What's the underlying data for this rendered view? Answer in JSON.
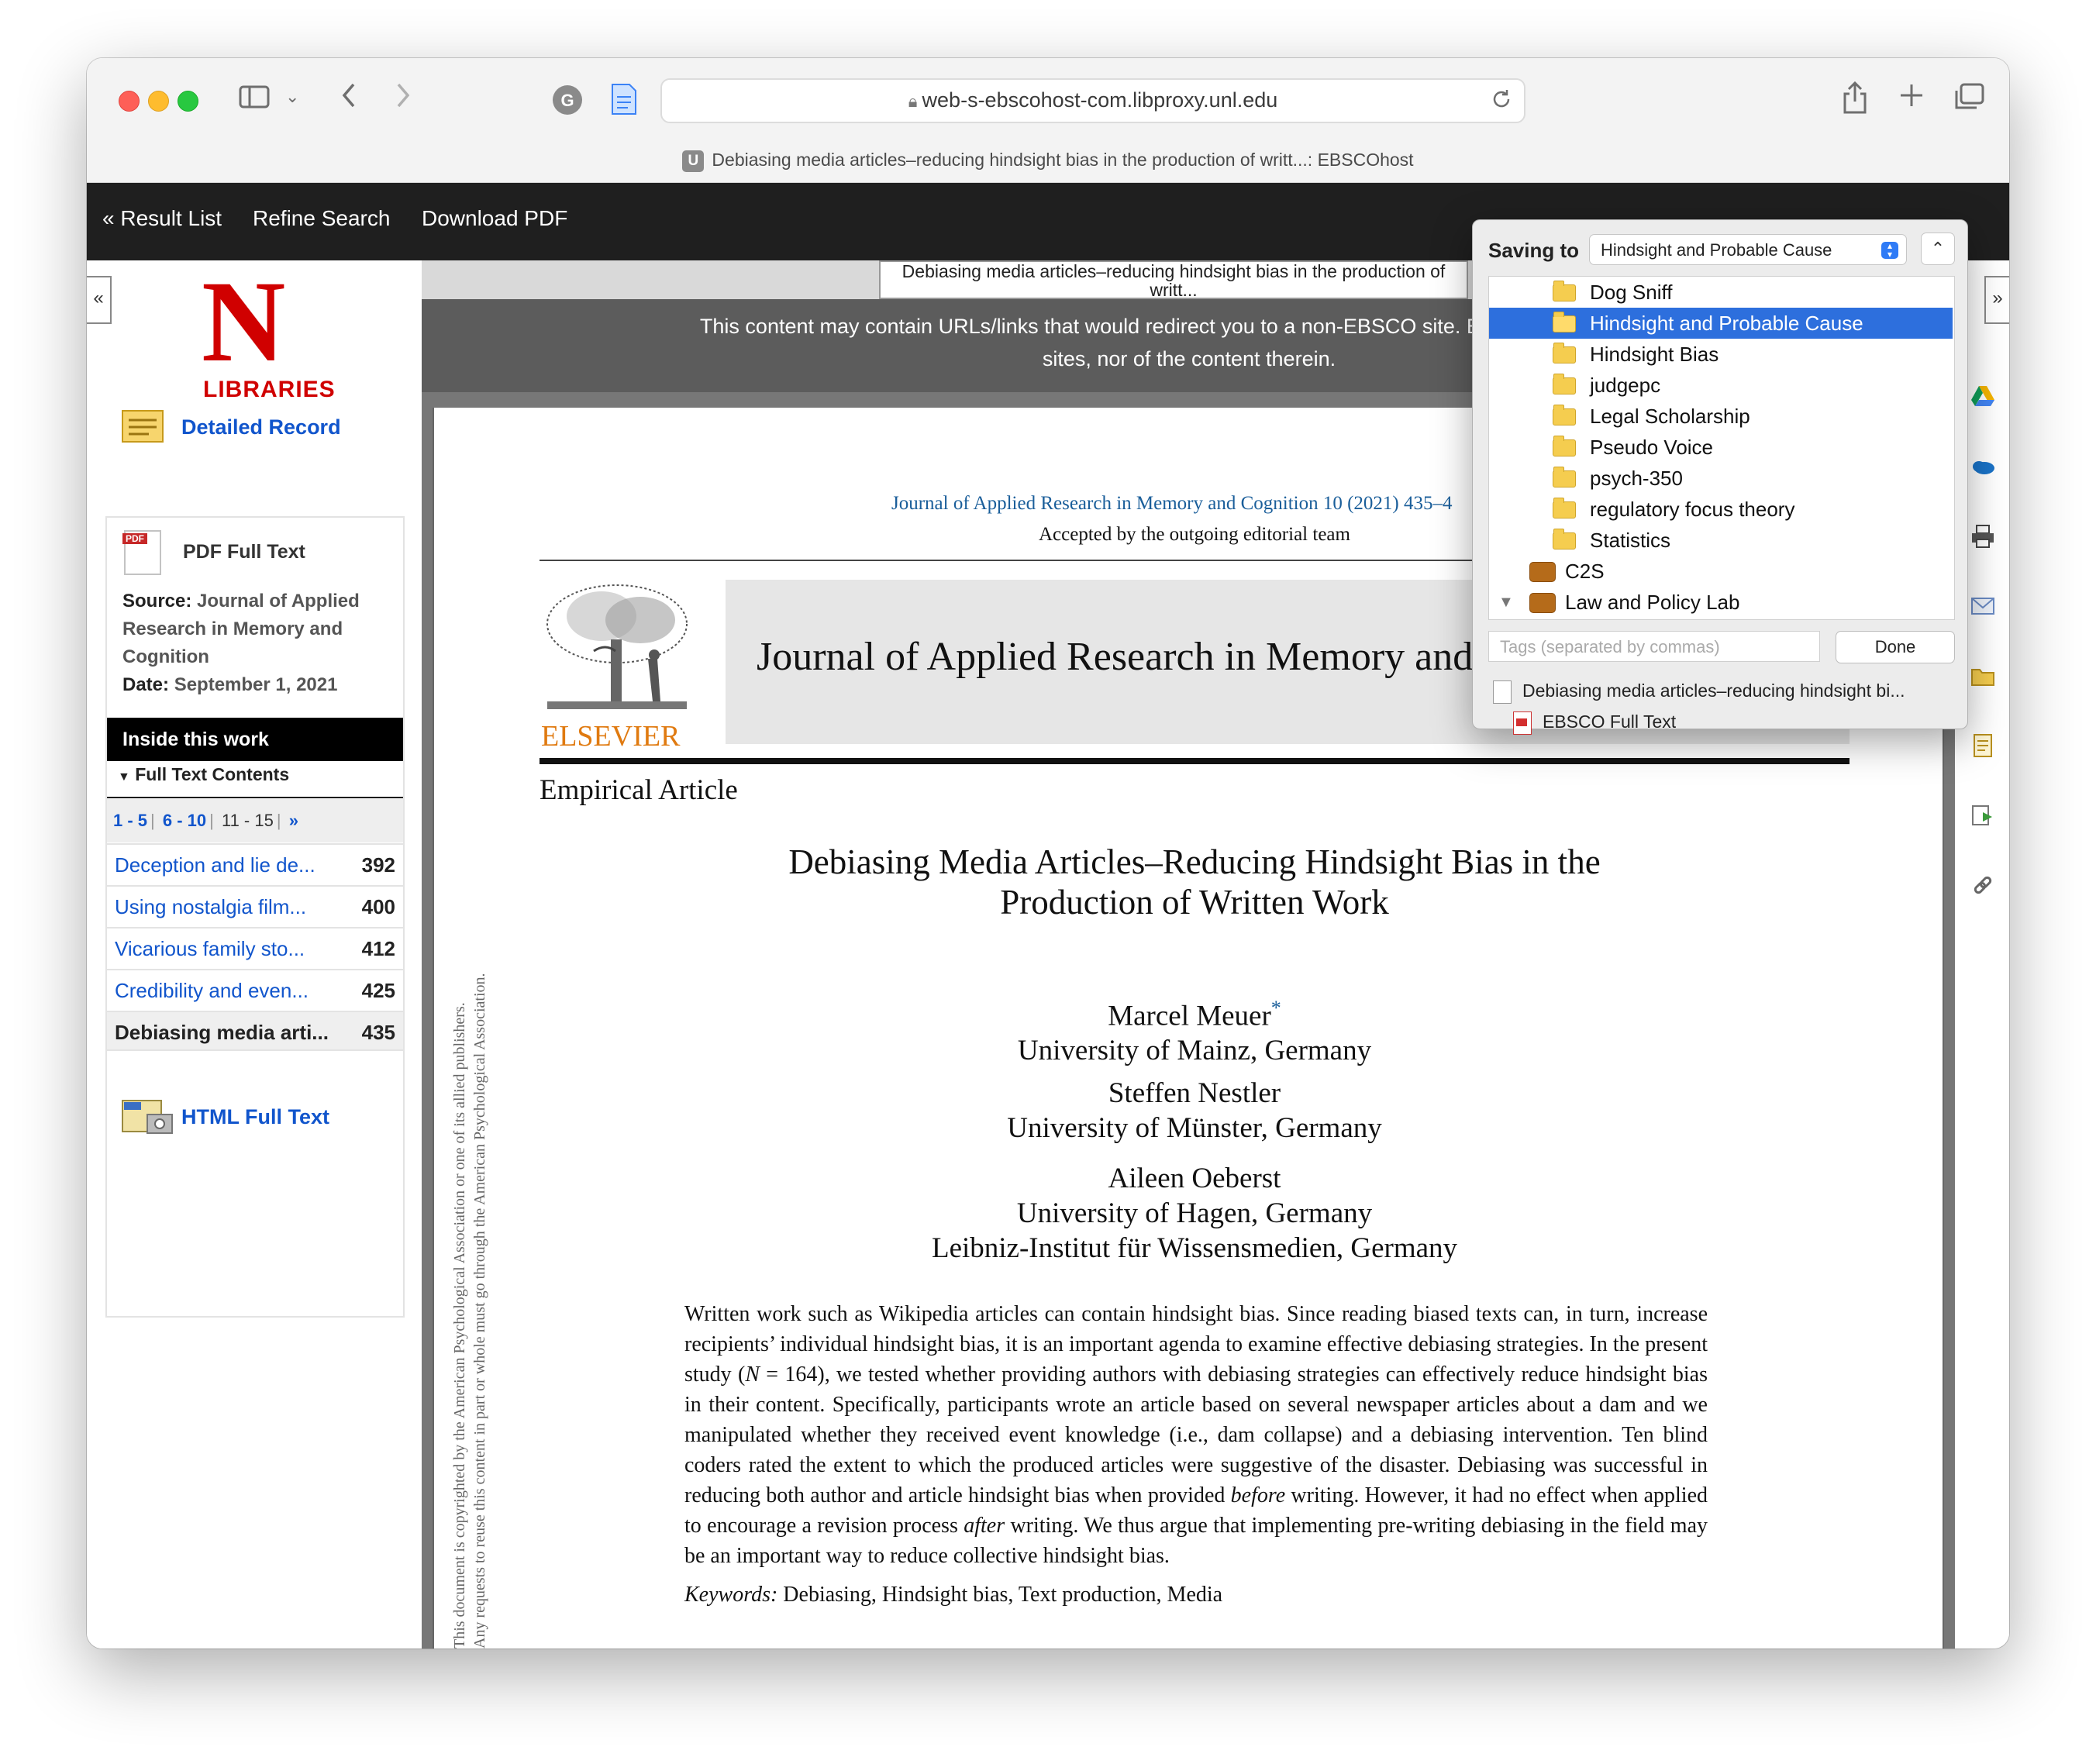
{
  "browser": {
    "url": "web-s-ebscohost-com.libproxy.unl.edu",
    "tab_title": "Debiasing media articles–reducing hindsight bias in the production of writt...: EBSCOhost",
    "tab_favicon": "U"
  },
  "nav": {
    "result_list": "« Result List",
    "refine_search": "Refine Search",
    "download_pdf": "Download PDF"
  },
  "sidebar": {
    "logo_letter": "N",
    "logo_text": "LIBRARIES",
    "detailed_record": "Detailed Record",
    "pdf_full_text": "PDF Full Text",
    "source_label": "Source:",
    "source_value": "Journal of Applied Research in Memory and Cognition",
    "date_label": "Date:",
    "date_value": "September 1, 2021",
    "inside_header": "Inside this work",
    "full_text_contents": "Full Text Contents",
    "pager": [
      "1 - 5",
      "6 - 10",
      "11 - 15",
      "»"
    ],
    "toc": [
      {
        "title": "Deception and lie de...",
        "page": "392"
      },
      {
        "title": "Using nostalgia film...",
        "page": "400"
      },
      {
        "title": "Vicarious family sto...",
        "page": "412"
      },
      {
        "title": "Credibility and even...",
        "page": "425"
      },
      {
        "title": "Debiasing media arti...",
        "page": "435"
      }
    ],
    "html_full_text": "HTML Full Text"
  },
  "viewer": {
    "doc_title": "Debiasing media articles–reducing hindsight bias in the production of writt...",
    "banner": "This content may contain URLs/links that would redirect you to a non-EBSCO site. EBSCO does not endo... sites, nor of the content therein.",
    "banner_line1": "This content may contain URLs/links that would redirect you to a non-EBSCO site. EBSCO does not endo",
    "banner_line2": "sites, nor of the content therein."
  },
  "article": {
    "journal_line": "Journal of Applied Research in Memory and Cognition 10 (2021) 435–4",
    "accepted": "Accepted by the outgoing editorial team",
    "publisher": "ELSEVIER",
    "journal_name": "Journal of Applied Research in Memory and",
    "article_type": "Empirical Article",
    "title_line1": "Debiasing Media Articles–Reducing Hindsight Bias in the",
    "title_line2": "Production of Written Work",
    "authors": [
      {
        "name": "Marcel Meuer",
        "affil": "University of Mainz, Germany"
      },
      {
        "name": "Steffen Nestler",
        "affil": "University of Münster, Germany"
      },
      {
        "name": "Aileen Oeberst",
        "affil": "University of Hagen, Germany",
        "affil2": "Leibniz-Institut für Wissensmedien, Germany"
      }
    ],
    "author_mark": "*",
    "abstract_part1": "Written work such as Wikipedia articles can contain hindsight bias. Since reading biased texts can, in turn, increase recipients’ individual hindsight bias, it is an important agenda to examine effective debiasing strategies. In the present study (",
    "abstract_n": "N",
    "abstract_part2": " = 164), we tested whether providing authors with debiasing strategies can effectively reduce hindsight bias in their content. Specifically, participants wrote an article based on several newspaper articles about a dam and we manipulated whether they received event knowledge (i.e., dam collapse) and a debiasing intervention. Ten blind coders rated the extent to which the produced articles were suggestive of the disaster. Debiasing was successful in reducing both author and article hindsight bias when provided ",
    "abstract_before": "before",
    "abstract_part3": " writing. However, it had no effect when applied to encourage a revision process ",
    "abstract_after": "after",
    "abstract_part4": " writing. We thus argue that implementing pre-writing debiasing in the field may be an important way to reduce collective hindsight bias.",
    "keywords_label": "Keywords:",
    "keywords": "Debiasing, Hindsight bias, Text production, Media",
    "copyright_line1": "This document is copyrighted by the American Psychological Association or one of its allied publishers.",
    "copyright_line2": "Any requests to reuse this content in part or whole must go through the American Psychological Association."
  },
  "zotero": {
    "saving_to_label": "Saving to",
    "selected_collection": "Hindsight and Probable Cause",
    "collections": [
      {
        "label": "Dog Sniff",
        "type": "folder"
      },
      {
        "label": "Hindsight and Probable Cause",
        "type": "folder",
        "selected": true
      },
      {
        "label": "Hindsight Bias",
        "type": "folder"
      },
      {
        "label": "judgepc",
        "type": "folder"
      },
      {
        "label": "Legal Scholarship",
        "type": "folder"
      },
      {
        "label": "Pseudo Voice",
        "type": "folder"
      },
      {
        "label": "psych-350",
        "type": "folder"
      },
      {
        "label": "regulatory focus theory",
        "type": "folder"
      },
      {
        "label": "Statistics",
        "type": "folder"
      },
      {
        "label": "C2S",
        "type": "library"
      },
      {
        "label": "Law and Policy Lab",
        "type": "library"
      }
    ],
    "tags_placeholder": "Tags (separated by commas)",
    "done_label": "Done",
    "item_title": "Debiasing media articles–reducing hindsight bi...",
    "attachment": "EBSCO Full Text"
  }
}
